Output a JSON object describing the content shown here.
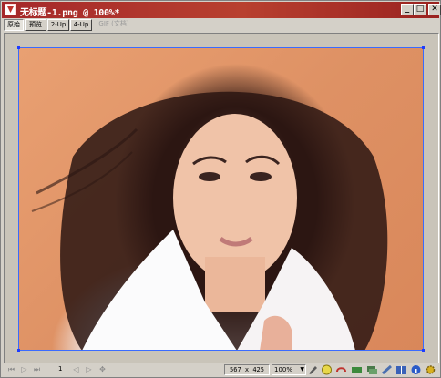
{
  "window": {
    "title": "无标题-1.png @ 100%*",
    "icon": "fireworks-document-icon",
    "controls": [
      "minimize-icon",
      "maximize-icon",
      "close-icon"
    ]
  },
  "tabs": [
    {
      "label": "原始",
      "active": true,
      "enabled": true
    },
    {
      "label": "预览",
      "active": false,
      "enabled": true
    },
    {
      "label": "2-Up",
      "active": false,
      "enabled": true
    },
    {
      "label": "4-Up",
      "active": false,
      "enabled": true
    },
    {
      "label": "GIF (文档)",
      "active": false,
      "enabled": false
    }
  ],
  "canvas": {
    "content": "portrait photo",
    "guide_color": "#3a6bff",
    "handle_color": "#1e3cff"
  },
  "status": {
    "frame_number": "1",
    "dimensions": "567 x 425",
    "zoom": "100%",
    "nav_icons": [
      "first-frame-icon",
      "play-icon",
      "last-frame-icon",
      "prev-frame-icon",
      "next-frame-icon",
      "loop-icon"
    ],
    "tool_icons": [
      "pencil-icon",
      "quick-export-icon",
      "rotate-icon",
      "optimize-icon",
      "layers-icon",
      "link-icon",
      "book-icon",
      "info-icon",
      "gear-icon"
    ]
  }
}
